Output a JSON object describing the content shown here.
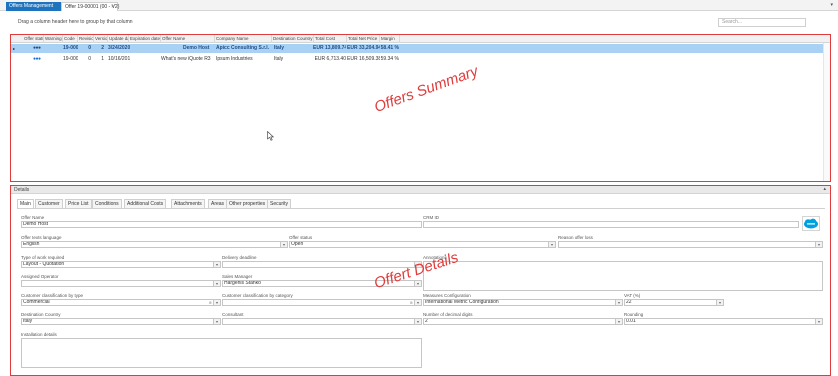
{
  "tabs": {
    "main": "Offers Management",
    "doc": "Offer 19-00001 (00 - V2)",
    "close_glyph": "×",
    "menu_glyph": "▾"
  },
  "toolbar": {
    "group_hint": "Drag a column header here to group by that column",
    "search_placeholder": "Search..."
  },
  "grid": {
    "columns": [
      "Offer status",
      "Warning",
      "Code",
      "Revision",
      "Version",
      "Update date",
      "Expiration date",
      "Offer Name",
      "Company Name",
      "Destination Country",
      "Total Cost",
      "Total Net Price",
      "Margin"
    ],
    "rows": [
      {
        "status": "●●●",
        "warning": "",
        "code": "19-00001",
        "revision": "0",
        "version": "2",
        "update_date": "3/24/2020",
        "expiration_date": "",
        "offer_name": "Demo Host",
        "company": "Apicc Consulting S.r.l.",
        "country": "Italy",
        "total_cost": "EUR 13,809.74",
        "net_price": "EUR 33,204.94",
        "margin": "58.41 %"
      },
      {
        "status": "●●●",
        "warning": "",
        "code": "19-00002",
        "revision": "0",
        "version": "1",
        "update_date": "10/16/2019",
        "expiration_date": "",
        "offer_name": "What's new iQuote R3",
        "company": "Ipsum Industries",
        "country": "Italy",
        "total_cost": "EUR 6,713.40",
        "net_price": "EUR 16,509.38",
        "margin": "59.34 %"
      }
    ],
    "row_indicator": "▸"
  },
  "annotations": {
    "summary": "Offers Summary",
    "details": "Offert Details"
  },
  "details": {
    "title": "Details",
    "toggle": "▴",
    "tabs": [
      "Main",
      "Customer",
      "Price List",
      "Conditions",
      "Additional Costs",
      "Attachments",
      "Areas",
      "Other properties",
      "Security"
    ],
    "fields": {
      "offer_name_label": "Offer Name",
      "offer_name_value": "Demo Host",
      "crm_id_label": "CRM ID",
      "crm_id_value": "",
      "language_label": "Offer texts language",
      "language_value": "English",
      "status_label": "Offer status",
      "status_value": "Open",
      "loss_label": "Reason offer loss",
      "loss_value": "",
      "work_label": "Type of work required",
      "work_value": "Layout - Quotation",
      "deadline_label": "Delivery deadline",
      "deadline_value": "",
      "annotations_label": "Annotations",
      "operator_label": "Assigned Operator",
      "operator_value": "",
      "sales_label": "Sales Manager",
      "sales_value": "Hargenis Stanko",
      "class_type_label": "Customer classification by type",
      "class_type_value": "Commercial",
      "class_cat_label": "Customer classification by category",
      "class_cat_value": "",
      "measures_label": "Measures Configuration",
      "measures_value": "International Metric Configuration",
      "vat_label": "VAT (%)",
      "vat_value": "22",
      "dest_label": "Destination Country",
      "dest_value": "Italy",
      "consultant_label": "Consultant",
      "consultant_value": "",
      "decimals_label": "Number of decimal digits",
      "decimals_value": "2",
      "rounding_label": "Rounding",
      "rounding_value": "0.01",
      "install_label": "Installation details"
    },
    "dropdown_glyph": "▾",
    "clear_glyph": "⊗"
  },
  "colors": {
    "accent": "#1e73be",
    "highlight": "#e03c3c",
    "selected_row": "#a9d1f4",
    "cloud": "#00a1e0"
  }
}
